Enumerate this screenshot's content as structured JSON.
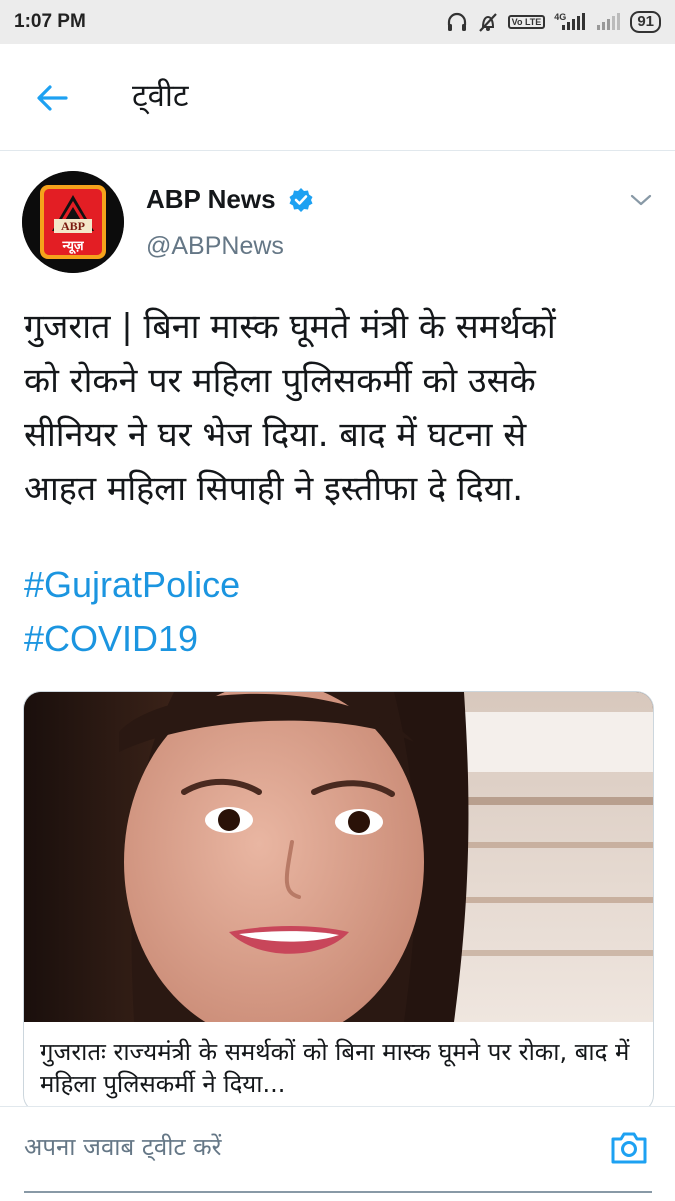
{
  "status_bar": {
    "time": "1:07 PM",
    "network_badge": "Vo LTE",
    "network_type": "4G",
    "battery": "91"
  },
  "header": {
    "title": "ट्वीट"
  },
  "tweet": {
    "author": {
      "name": "ABP News",
      "handle": "@ABPNews",
      "verified": true,
      "avatar_logo_text_top": "ABP",
      "avatar_logo_text_bottom": "न्यूज़"
    },
    "text_lines": [
      "गुजरात | बिना मास्क घूमते मंत्री के समर्थकों",
      "को रोकने पर महिला पुलिसकर्मी को उसके",
      "सीनियर ने घर भेज दिया. बाद में घटना से",
      "आहत महिला सिपाही ने इस्तीफा दे दिया."
    ],
    "hashtags": [
      "#GujratPolice",
      "#COVID19"
    ],
    "card": {
      "title": "गुजरातः राज्यमंत्री के समर्थकों को बिना मास्क घूमने पर रोका, बाद में महिला पुलिसकर्मी ने दिया..."
    }
  },
  "composer": {
    "placeholder": "अपना जवाब ट्वीट करें"
  },
  "colors": {
    "accent": "#1da1f2",
    "hashtag": "#1b95e0",
    "text": "#14171a",
    "secondary": "#657786",
    "status_bar_bg": "#ececec",
    "logo_red": "#e31e24",
    "logo_gold": "#f5a21b"
  },
  "icons": {
    "back": "arrow-left-icon",
    "verified": "verified-badge-icon",
    "caret": "chevron-down-icon",
    "camera": "camera-icon"
  }
}
